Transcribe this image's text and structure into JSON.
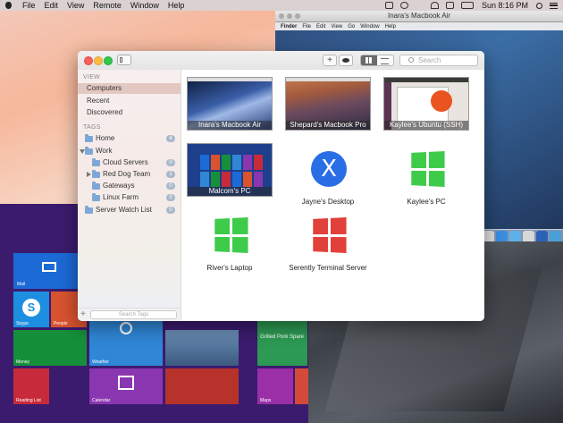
{
  "menubar": {
    "items": [
      "File",
      "Edit",
      "View",
      "Remote",
      "Window",
      "Help"
    ],
    "clock": "Sun 8:16 PM"
  },
  "remote_mac": {
    "title": "Inara's Macbook Air",
    "menu": [
      "Finder",
      "File",
      "Edit",
      "View",
      "Go",
      "Window",
      "Help"
    ]
  },
  "app": {
    "search_placeholder": "Search",
    "sidebar": {
      "view_header": "VIEW",
      "view_items": [
        "Computers",
        "Recent",
        "Discovered"
      ],
      "tags_header": "TAGS",
      "tags": [
        {
          "label": "Home",
          "badge": "4"
        },
        {
          "label": "Work",
          "badge": ""
        },
        {
          "label": "Cloud Servers",
          "badge": "0"
        },
        {
          "label": "Red Dog Team",
          "badge": "1"
        },
        {
          "label": "Gateways",
          "badge": "0"
        },
        {
          "label": "Linux Farm",
          "badge": "0"
        },
        {
          "label": "Server Watch List",
          "badge": "0"
        }
      ],
      "tag_search_placeholder": "Search Tags"
    },
    "computers": [
      {
        "label": "Inara's Macbook Air",
        "kind": "mac-screenshot"
      },
      {
        "label": "Shepard's Macbook Pro",
        "kind": "mac-screenshot"
      },
      {
        "label": "Kaylee's Ubuntu (SSH)",
        "kind": "ubuntu-screenshot"
      },
      {
        "label": "Malcom's PC",
        "kind": "windows-screenshot"
      },
      {
        "label": "Jayne's Desktop",
        "kind": "x-icon"
      },
      {
        "label": "Kaylee's PC",
        "kind": "windows-green-icon"
      },
      {
        "label": "River's Laptop",
        "kind": "windows-green-icon"
      },
      {
        "label": "Serently Terminal Server",
        "kind": "windows-red-icon"
      }
    ]
  },
  "win8": {
    "tiles": [
      "Mail",
      "Skype",
      "People",
      "Money",
      "Weather",
      "Calendar",
      "Reading List",
      "Grilled Pork Spare",
      "Maps"
    ]
  },
  "colors": {
    "selection": "#e3c8c1",
    "win8_bg": "#3b1b6e",
    "windows_green": "#3ecb4a",
    "windows_red": "#e2403a",
    "x_blue": "#2a6ee6"
  }
}
